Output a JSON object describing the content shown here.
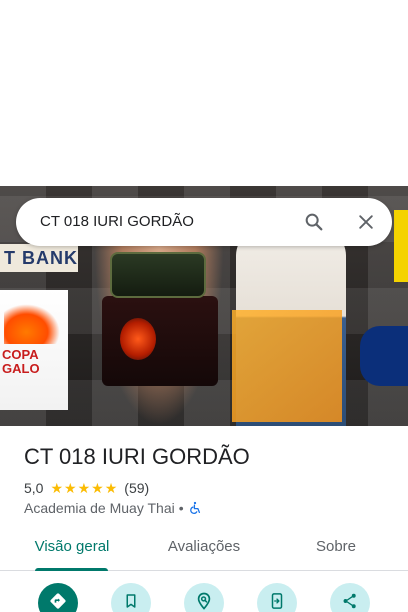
{
  "search": {
    "query": "CT 018 IURI GORDÃO"
  },
  "place": {
    "name": "CT 018 IURI GORDÃO",
    "rating": "5,0",
    "review_count": "(59)",
    "stars_filled": 5,
    "category": "Academia de Muay Thai",
    "separator": "•"
  },
  "tabs": [
    {
      "label": "Visão geral",
      "active": true
    },
    {
      "label": "Avaliações",
      "active": false
    },
    {
      "label": "Sobre",
      "active": false
    }
  ],
  "actions": [
    {
      "icon": "directions-icon"
    },
    {
      "icon": "bookmark-icon"
    },
    {
      "icon": "nearby-icon"
    },
    {
      "icon": "send-to-phone-icon"
    },
    {
      "icon": "share-icon"
    }
  ],
  "colors": {
    "accent": "#00796b",
    "star": "#fbbc04",
    "action_bg": "#c9eef0",
    "accessibility": "#1a73e8"
  }
}
